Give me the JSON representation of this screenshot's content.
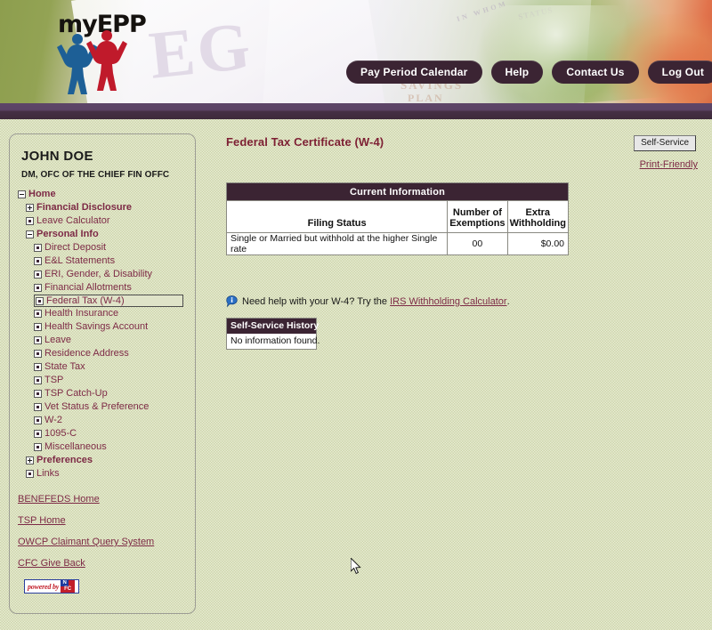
{
  "header": {
    "logo_text": "myEPP",
    "logo_icon": "two-people-celebrating-icon",
    "ghost_eg": "EG",
    "ghost_savings": "SAVINGS",
    "ghost_plan": "PLAN",
    "ghost_status": "STATUS",
    "ghost_inwhom": "IN WHOM",
    "nav": [
      {
        "label": "Pay Period Calendar",
        "name": "nav-pay-period-calendar"
      },
      {
        "label": "Help",
        "name": "nav-help"
      },
      {
        "label": "Contact Us",
        "name": "nav-contact-us"
      },
      {
        "label": "Log Out",
        "name": "nav-log-out"
      }
    ]
  },
  "sidebar": {
    "user_name": "JOHN DOE",
    "user_org": "DM, OFC OF THE CHIEF FIN OFFC",
    "tree": [
      {
        "label": "Home",
        "level": 0,
        "icon": "minus-box-icon",
        "bold": true,
        "selected": false
      },
      {
        "label": "Financial Disclosure",
        "level": 1,
        "icon": "plus-box-icon",
        "bold": true,
        "selected": false
      },
      {
        "label": "Leave Calculator",
        "level": 1,
        "icon": "dot-box-icon",
        "bold": false,
        "selected": false
      },
      {
        "label": "Personal Info",
        "level": 1,
        "icon": "minus-box-icon",
        "bold": true,
        "selected": false
      },
      {
        "label": "Direct Deposit",
        "level": 2,
        "icon": "dot-box-icon",
        "bold": false,
        "selected": false
      },
      {
        "label": "E&L Statements",
        "level": 2,
        "icon": "dot-box-icon",
        "bold": false,
        "selected": false
      },
      {
        "label": "ERI, Gender, & Disability",
        "level": 2,
        "icon": "dot-box-icon",
        "bold": false,
        "selected": false
      },
      {
        "label": "Financial Allotments",
        "level": 2,
        "icon": "dot-box-icon",
        "bold": false,
        "selected": false
      },
      {
        "label": "Federal Tax (W-4)",
        "level": 2,
        "icon": "dot-box-icon",
        "bold": false,
        "selected": true
      },
      {
        "label": "Health Insurance",
        "level": 2,
        "icon": "dot-box-icon",
        "bold": false,
        "selected": false
      },
      {
        "label": "Health Savings Account",
        "level": 2,
        "icon": "dot-box-icon",
        "bold": false,
        "selected": false
      },
      {
        "label": "Leave",
        "level": 2,
        "icon": "dot-box-icon",
        "bold": false,
        "selected": false
      },
      {
        "label": "Residence Address",
        "level": 2,
        "icon": "dot-box-icon",
        "bold": false,
        "selected": false
      },
      {
        "label": "State Tax",
        "level": 2,
        "icon": "dot-box-icon",
        "bold": false,
        "selected": false
      },
      {
        "label": "TSP",
        "level": 2,
        "icon": "dot-box-icon",
        "bold": false,
        "selected": false
      },
      {
        "label": "TSP Catch-Up",
        "level": 2,
        "icon": "dot-box-icon",
        "bold": false,
        "selected": false
      },
      {
        "label": "Vet Status & Preference",
        "level": 2,
        "icon": "dot-box-icon",
        "bold": false,
        "selected": false
      },
      {
        "label": "W-2",
        "level": 2,
        "icon": "dot-box-icon",
        "bold": false,
        "selected": false
      },
      {
        "label": "1095-C",
        "level": 2,
        "icon": "dot-box-icon",
        "bold": false,
        "selected": false
      },
      {
        "label": "Miscellaneous",
        "level": 2,
        "icon": "dot-box-icon",
        "bold": false,
        "selected": false
      },
      {
        "label": "Preferences",
        "level": 1,
        "icon": "plus-box-icon",
        "bold": true,
        "selected": false
      },
      {
        "label": "Links",
        "level": 1,
        "icon": "dot-box-icon",
        "bold": false,
        "selected": false
      }
    ],
    "links": [
      {
        "label": "BENEFEDS Home",
        "name": "link-benefeds-home"
      },
      {
        "label": "TSP Home",
        "name": "link-tsp-home"
      },
      {
        "label": "OWCP Claimant Query System",
        "name": "link-owcp-claimant-query-system"
      },
      {
        "label": "CFC Give Back",
        "name": "link-cfc-give-back"
      }
    ],
    "badge": {
      "powered_by": "powered by",
      "n": "N",
      "c": "FC"
    }
  },
  "main": {
    "page_title": "Federal Tax Certificate (W-4)",
    "table": {
      "caption": "Current Information",
      "columns": [
        "Filing Status",
        "Number of Exemptions",
        "Extra Withholding"
      ],
      "column_lines": [
        [
          "Filing Status"
        ],
        [
          "Number of",
          "Exemptions"
        ],
        [
          "Extra",
          "Withholding"
        ]
      ],
      "rows": [
        {
          "filing_status": "Single or Married but withhold at the higher Single rate",
          "exemptions": "00",
          "extra_withholding": "$0.00"
        }
      ]
    },
    "help": {
      "icon": "info-balloon-icon",
      "text_before": "Need help with your W-4? Try the",
      "link_text": "IRS Withholding Calculator",
      "text_after": "."
    },
    "history": {
      "title": "Self-Service History",
      "body": "No information found."
    }
  },
  "toolbar": {
    "self_service_label": "Self-Service",
    "print_friendly_label": "Print-Friendly"
  },
  "colors": {
    "accent_maroon": "#7d2a46",
    "title_maroon": "#7d1f33",
    "header_purple": "#3b2433",
    "bar_purple": "#5b4365",
    "page_bg": "#cdd5aa"
  }
}
